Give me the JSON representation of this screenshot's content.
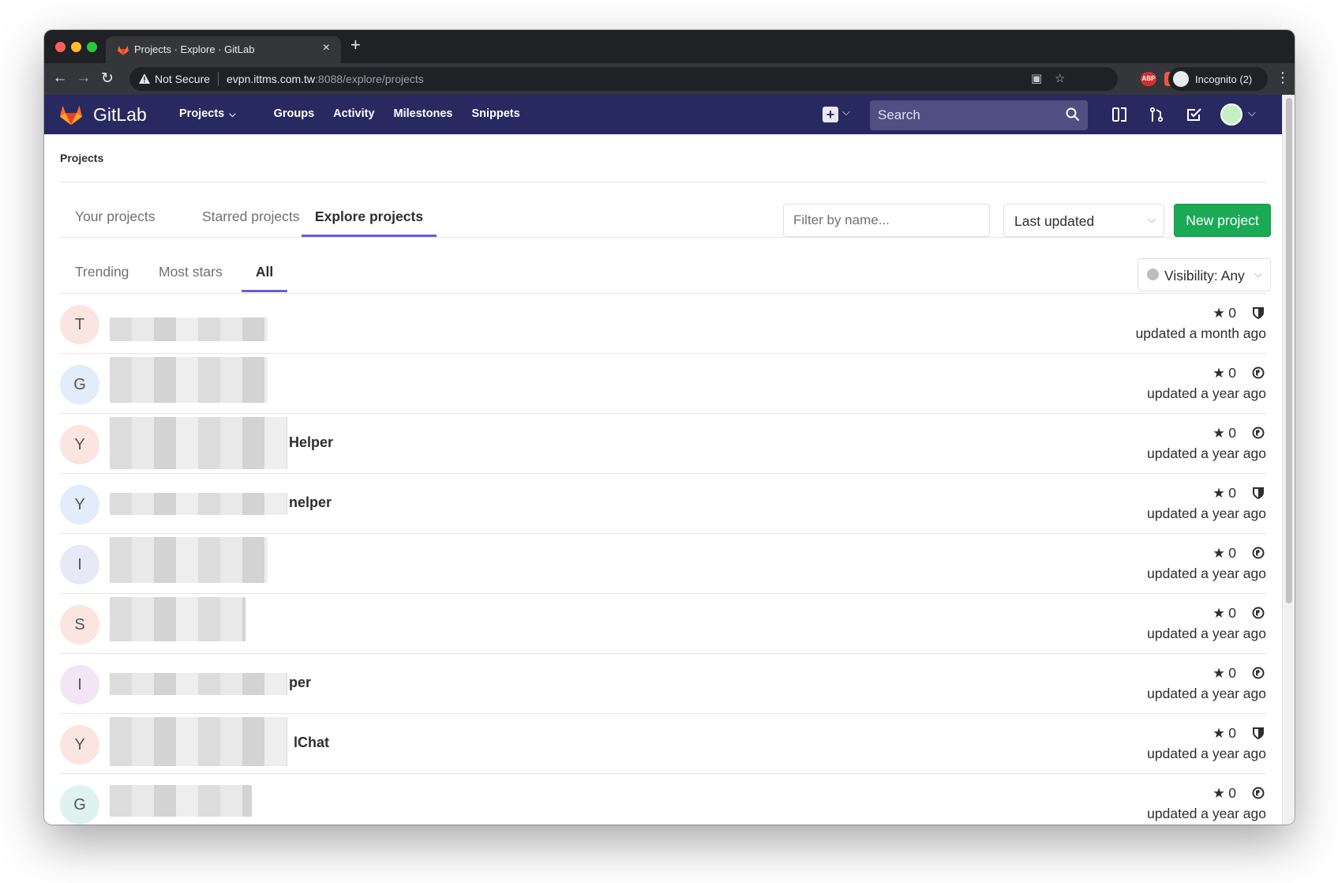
{
  "browser": {
    "tab_title": "Projects · Explore · GitLab",
    "tab_close": "×",
    "new_tab": "+",
    "not_secure": "Not Secure",
    "url_host": "evpn.ittms.com.tw",
    "url_path": ":8088/explore/projects",
    "ext_abp": "ABP",
    "profile": "Incognito (2)"
  },
  "navbar": {
    "brand": "GitLab",
    "links": [
      "Projects",
      "Groups",
      "Activity",
      "Milestones",
      "Snippets"
    ],
    "search_placeholder": "Search"
  },
  "breadcrumb": "Projects",
  "tabs": [
    "Your projects",
    "Starred projects",
    "Explore projects"
  ],
  "active_tab": "Explore projects",
  "filter_placeholder": "Filter by name...",
  "sort_value": "Last updated",
  "new_project": "New project",
  "subtabs": [
    "Trending",
    "Most stars",
    "All"
  ],
  "active_subtab": "All",
  "visibility_filter": "Visibility: Any",
  "projects": [
    {
      "initial": "T",
      "name": "",
      "stars": "0",
      "visibility": "internal",
      "updated": "updated a month ago",
      "color": "#fbe5e1"
    },
    {
      "initial": "G",
      "name": "",
      "stars": "0",
      "visibility": "public",
      "updated": "updated a year ago",
      "color": "#e2ecfb"
    },
    {
      "initial": "Y",
      "name": "Helper",
      "stars": "0",
      "visibility": "public",
      "updated": "updated a year ago",
      "color": "#fbe5e1"
    },
    {
      "initial": "Y",
      "name": "nelper",
      "stars": "0",
      "visibility": "internal",
      "updated": "updated a year ago",
      "color": "#e2ecfb"
    },
    {
      "initial": "I",
      "name": "",
      "stars": "0",
      "visibility": "public",
      "updated": "updated a year ago",
      "color": "#e8e9f7"
    },
    {
      "initial": "S",
      "name": "",
      "stars": "0",
      "visibility": "public",
      "updated": "updated a year ago",
      "color": "#fbe5e1"
    },
    {
      "initial": "I",
      "name": "per",
      "stars": "0",
      "visibility": "public",
      "updated": "updated a year ago",
      "color": "#f3e5f5"
    },
    {
      "initial": "Y",
      "name": "lChat",
      "stars": "0",
      "visibility": "internal",
      "updated": "updated a year ago",
      "color": "#fbe5e1"
    },
    {
      "initial": "G",
      "name": "",
      "stars": "0",
      "visibility": "public",
      "updated": "updated a year ago",
      "color": "#e0f2ef"
    }
  ],
  "colors": {
    "navbar": "#292961",
    "accent": "#6b5dd3",
    "new_project": "#1aaa55"
  }
}
